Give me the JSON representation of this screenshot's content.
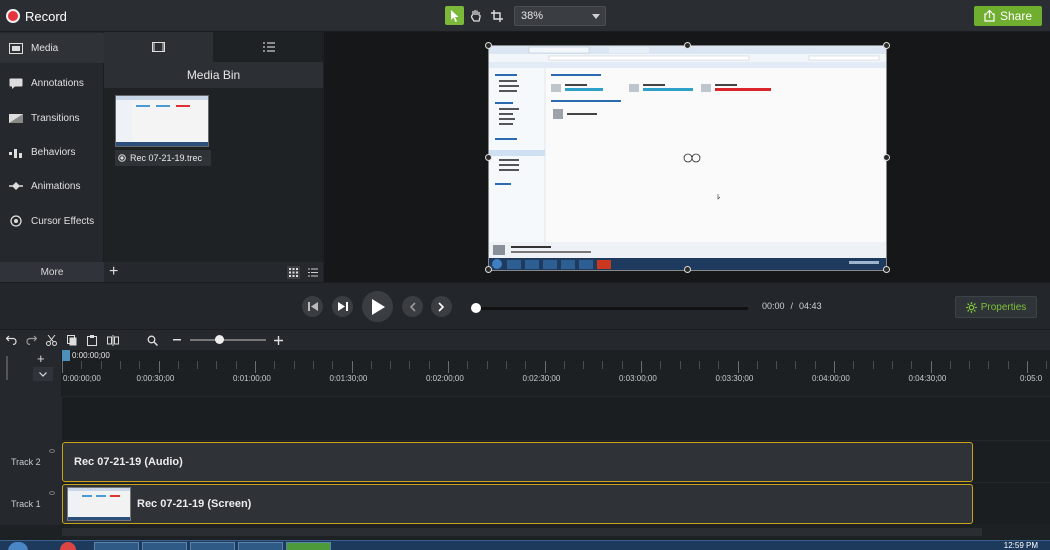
{
  "app": {
    "record_label": "Record",
    "zoom_value": "38%",
    "share_label": "Share"
  },
  "colors": {
    "accent_green": "#6fae2f",
    "record_red": "#e5343d",
    "clip_border": "#c9a41b"
  },
  "sidebar": {
    "items": [
      {
        "label": "Media",
        "icon": "film-icon"
      },
      {
        "label": "Annotations",
        "icon": "annotation-icon"
      },
      {
        "label": "Transitions",
        "icon": "transition-icon"
      },
      {
        "label": "Behaviors",
        "icon": "behaviors-icon"
      },
      {
        "label": "Animations",
        "icon": "animation-icon"
      },
      {
        "label": "Cursor Effects",
        "icon": "cursor-icon"
      }
    ],
    "more_label": "More"
  },
  "media_bin": {
    "title": "Media Bin",
    "items": [
      {
        "name": "Rec 07-21-19.trec"
      }
    ]
  },
  "playback": {
    "current_time": "00:00",
    "separator": "/",
    "duration": "04:43",
    "properties_label": "Properties",
    "progress": 0
  },
  "timeline": {
    "playhead_time": "0:00:00;00",
    "ruler_labels": [
      "0:00:00;00",
      "0:00:30;00",
      "0:01:00;00",
      "0:01:30;00",
      "0:02:00;00",
      "0:02:30;00",
      "0:03:00;00",
      "0:03:30;00",
      "0:04:00;00",
      "0:04:30;00",
      "0:05:0"
    ],
    "tracks": [
      {
        "label": "Track 2",
        "clip": "Rec 07-21-19 (Audio)"
      },
      {
        "label": "Track 1",
        "clip": "Rec 07-21-19 (Screen)"
      }
    ]
  },
  "taskbar": {
    "clock": "12:59 PM"
  }
}
